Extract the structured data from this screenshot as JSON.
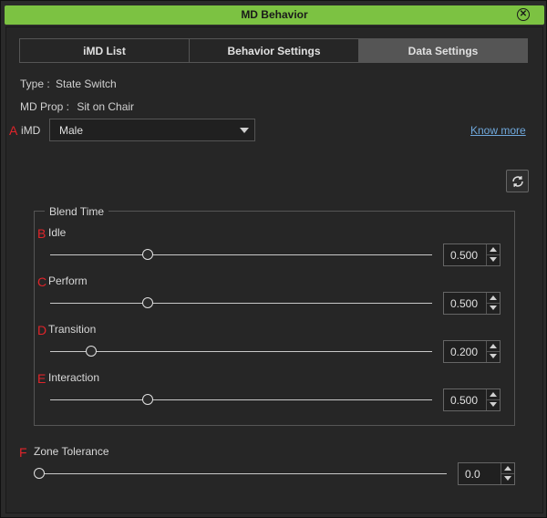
{
  "window": {
    "title": "MD Behavior"
  },
  "tabs": [
    {
      "label": "iMD List",
      "active": false
    },
    {
      "label": "Behavior Settings",
      "active": false
    },
    {
      "label": "Data Settings",
      "active": true
    }
  ],
  "info": {
    "type_label": "Type :",
    "type_value": "State Switch",
    "prop_label": "MD Prop :",
    "prop_value": "Sit on Chair"
  },
  "imd": {
    "letter": "A",
    "label": "iMD",
    "selected": "Male",
    "know_more": "Know more"
  },
  "blend_time": {
    "title": "Blend Time",
    "rows": [
      {
        "letter": "B",
        "label": "Idle",
        "value": "0.500",
        "slider_fraction": 0.255
      },
      {
        "letter": "C",
        "label": "Perform",
        "value": "0.500",
        "slider_fraction": 0.255
      },
      {
        "letter": "D",
        "label": "Transition",
        "value": "0.200",
        "slider_fraction": 0.107
      },
      {
        "letter": "E",
        "label": "Interaction",
        "value": "0.500",
        "slider_fraction": 0.255
      }
    ]
  },
  "zone_tolerance": {
    "letter": "F",
    "label": "Zone Tolerance",
    "value": "0.0",
    "slider_fraction": 0.0
  },
  "colors": {
    "titlebar": "#7cc242",
    "marker": "#e0242a",
    "link": "#6fa8dc",
    "active_tab": "#555555"
  },
  "icons": {
    "close": "close-circle-icon",
    "reset": "refresh-icon",
    "dropdown": "chevron-down-icon"
  }
}
